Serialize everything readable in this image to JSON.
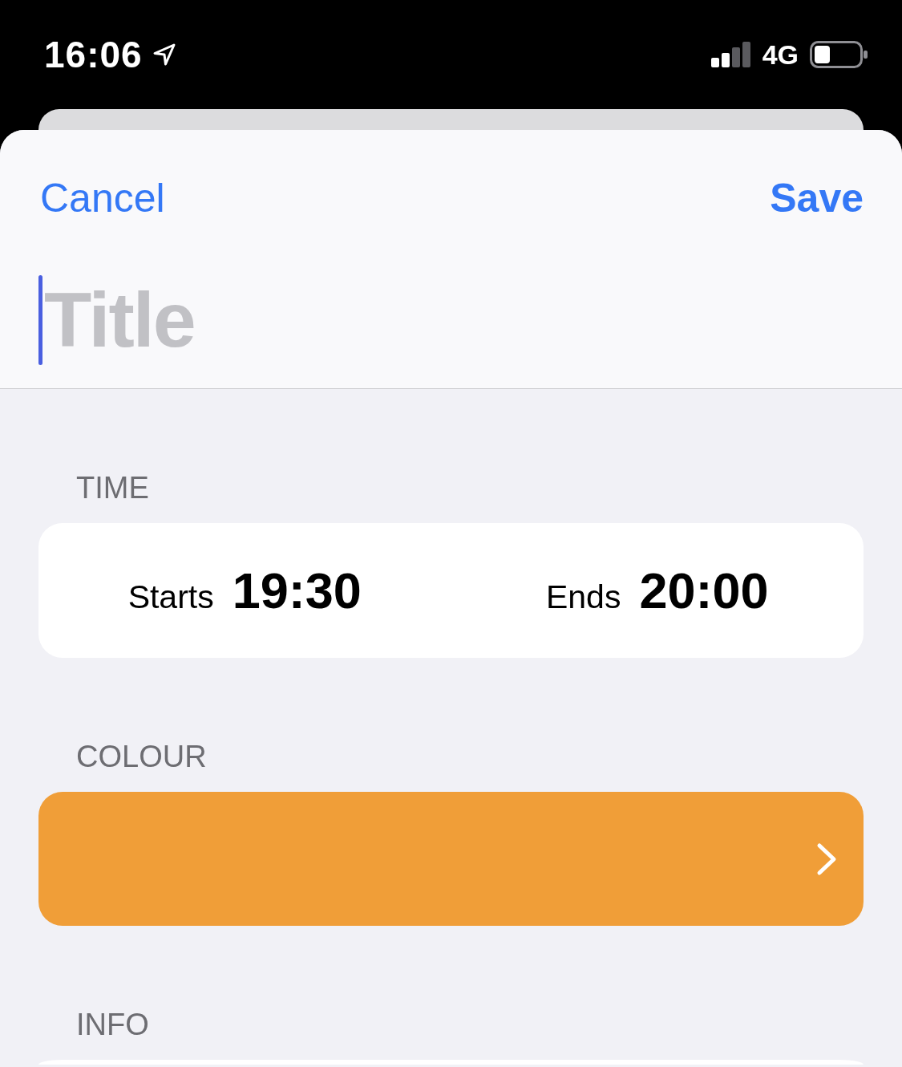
{
  "status_bar": {
    "time": "16:06",
    "network": "4G"
  },
  "nav": {
    "cancel": "Cancel",
    "save": "Save"
  },
  "title_field": {
    "placeholder": "Title",
    "focused": true
  },
  "sections": [
    {
      "kind": "time",
      "header": "TIME",
      "start_label": "Starts",
      "start": "19:30",
      "end_label": "Ends",
      "end": "20:00"
    },
    {
      "kind": "colour",
      "header": "COLOUR",
      "color": "#f09e38"
    },
    {
      "kind": "info",
      "header": "INFO"
    }
  ]
}
